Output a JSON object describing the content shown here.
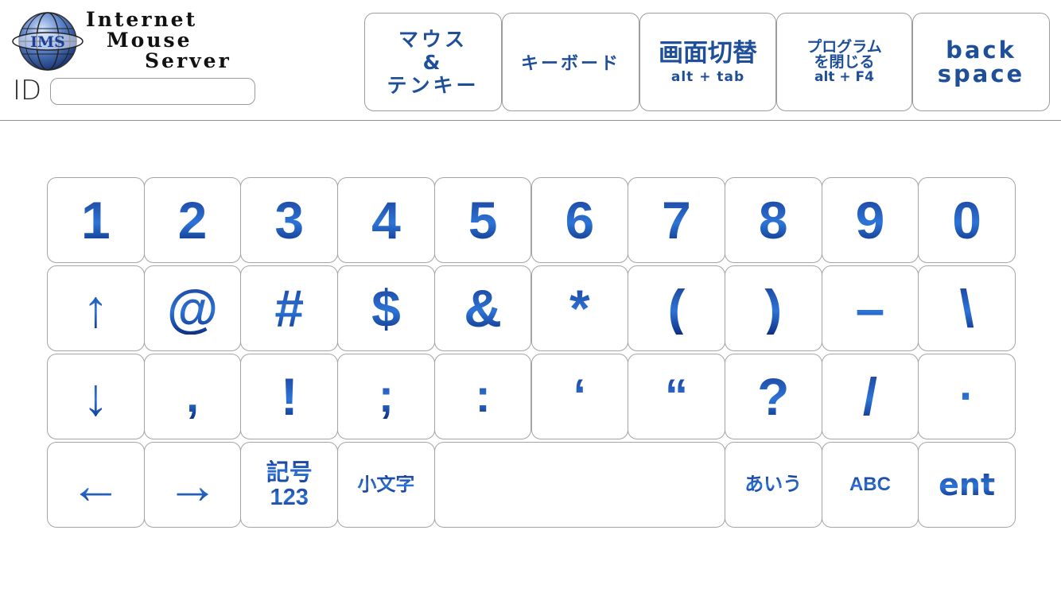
{
  "header": {
    "logo": {
      "badge": "IMS",
      "line1": "Internet",
      "line2": "Mouse",
      "line3": "Server"
    },
    "id_label": "ID",
    "id_input": {
      "value": "",
      "placeholder": ""
    },
    "buttons": [
      {
        "line1": "マウス",
        "line2": "&",
        "line3": "テンキー"
      },
      {
        "label": "キーボード"
      },
      {
        "line1": "画面切替",
        "line2": "alt + tab"
      },
      {
        "line1": "プログラム",
        "line2": "を閉じる",
        "line3": "alt + F4"
      },
      {
        "line1": "back",
        "line2": "space"
      }
    ]
  },
  "keyboard": {
    "rows": [
      [
        "1",
        "2",
        "3",
        "4",
        "5",
        "6",
        "7",
        "8",
        "9",
        "0"
      ],
      [
        "↑",
        "@",
        "#",
        "$",
        "&",
        "*",
        "(",
        ")",
        "–",
        "\\"
      ],
      [
        "↓",
        ",",
        "!",
        ";",
        ":",
        "‘",
        "“",
        "?",
        "/",
        "·"
      ],
      [
        "←",
        "→",
        "記号|123",
        "小文字",
        "",
        "あいう",
        "ABC",
        "ent"
      ]
    ]
  },
  "colors": {
    "key_text_top": "#1a3f98",
    "key_text_mid": "#2d74d6",
    "key_border": "#a4a4a4",
    "divider": "#8e8e8e"
  }
}
